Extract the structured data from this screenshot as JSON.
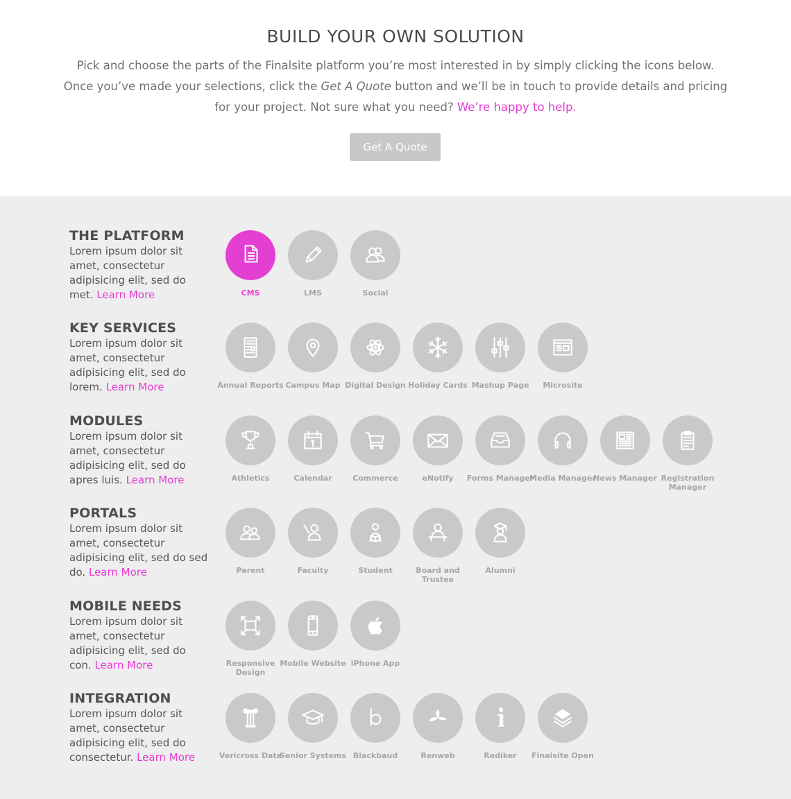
{
  "header": {
    "title": "BUILD YOUR OWN SOLUTION",
    "intro_part1": "Pick and choose the parts of the Finalsite platform you’re most interested in by simply clicking the icons below. Once you’ve made your selections, click the ",
    "intro_emphasis": "Get A Quote",
    "intro_part2": " button and we’ll be in touch to provide details and pricing for your project. Not sure what you need? ",
    "help_link": "We’re happy to help.",
    "quote_button": "Get A Quote"
  },
  "colors": {
    "accent": "#e43fd3",
    "icon_inactive": "#c9c9c9",
    "panel_bg": "#eeeeee",
    "button_bg": "#c8c8c8"
  },
  "sections": [
    {
      "title": "THE PLATFORM",
      "text": "Lorem ipsum dolor sit amet, consectetur adipisicing elit, sed do met.",
      "learn_more": "Learn More",
      "items": [
        {
          "label": "CMS",
          "icon": "document-icon",
          "selected": true
        },
        {
          "label": "LMS",
          "icon": "pencil-icon",
          "selected": false
        },
        {
          "label": "Social",
          "icon": "people-icon",
          "selected": false
        }
      ]
    },
    {
      "title": "KEY SERVICES",
      "text": "Lorem ipsum dolor sit amet, consectetur adipisicing elit, sed do lorem.",
      "learn_more": "Learn More",
      "items": [
        {
          "label": "Annual Reports",
          "icon": "report-icon"
        },
        {
          "label": "Campus Map",
          "icon": "map-pin-icon"
        },
        {
          "label": "Digital Design",
          "icon": "atom-icon"
        },
        {
          "label": "Holiday Cards",
          "icon": "snowflake-icon"
        },
        {
          "label": "Mashup Page",
          "icon": "sliders-icon"
        },
        {
          "label": "Microsite",
          "icon": "browser-icon"
        }
      ]
    },
    {
      "title": "MODULES",
      "text": "Lorem ipsum dolor sit amet, consectetur adipisicing elit, sed do apres luis.",
      "learn_more": "Learn More",
      "items": [
        {
          "label": "Athletics",
          "icon": "trophy-icon"
        },
        {
          "label": "Calendar",
          "icon": "calendar-icon"
        },
        {
          "label": "Commerce",
          "icon": "cart-icon"
        },
        {
          "label": "eNotify",
          "icon": "envelope-icon"
        },
        {
          "label": "Forms Manager",
          "icon": "inbox-icon"
        },
        {
          "label": "Media Manager",
          "icon": "headphones-icon"
        },
        {
          "label": "News Manager",
          "icon": "newspaper-icon"
        },
        {
          "label": "Registration Manager",
          "icon": "clipboard-icon"
        }
      ]
    },
    {
      "title": "PORTALS",
      "text": "Lorem ipsum dolor sit amet, consectetur adipisicing elit, sed do sed do.",
      "learn_more": "Learn More",
      "items": [
        {
          "label": "Parent",
          "icon": "parent-icon"
        },
        {
          "label": "Faculty",
          "icon": "teacher-icon"
        },
        {
          "label": "Student",
          "icon": "student-icon"
        },
        {
          "label": "Board and Trustee",
          "icon": "board-icon"
        },
        {
          "label": "Alumni",
          "icon": "graduate-icon"
        }
      ]
    },
    {
      "title": "MOBILE NEEDS",
      "text": "Lorem ipsum dolor sit amet, consectetur adipisicing elit, sed do con.",
      "learn_more": "Learn More",
      "items": [
        {
          "label": "Responsive Design",
          "icon": "expand-icon"
        },
        {
          "label": "Mobile Website",
          "icon": "phone-icon"
        },
        {
          "label": "iPhone App",
          "icon": "apple-icon"
        }
      ]
    },
    {
      "title": "INTEGRATION",
      "text": "Lorem ipsum dolor sit amet, consectetur adipisicing elit, sed do consectetur.",
      "learn_more": "Learn More",
      "items": [
        {
          "label": "Vericross Data",
          "icon": "column-icon"
        },
        {
          "label": "Senior Systems",
          "icon": "mortarboard-icon"
        },
        {
          "label": "Blackbaud",
          "icon": "blackbaud-icon"
        },
        {
          "label": "Renweb",
          "icon": "renweb-icon"
        },
        {
          "label": "Rediker",
          "icon": "rediker-icon"
        },
        {
          "label": "Finalsite Open",
          "icon": "layers-icon"
        }
      ]
    }
  ]
}
